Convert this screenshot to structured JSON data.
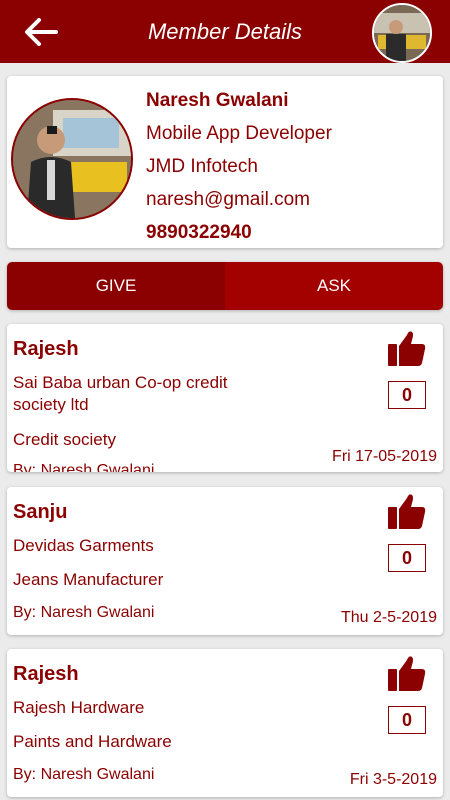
{
  "header": {
    "title": "Member Details"
  },
  "profile": {
    "name": "Naresh Gwalani",
    "designation": "Mobile App Developer",
    "company": "JMD Infotech",
    "email": "naresh@gmail.com",
    "phone": "9890322940"
  },
  "tabs": [
    {
      "label": "GIVE",
      "active": true
    },
    {
      "label": "ASK",
      "active": false
    }
  ],
  "entries": [
    {
      "name": "Rajesh",
      "business": "Sai Baba urban Co-op credit society ltd",
      "category": "Credit society",
      "by": "By: Naresh Gwalani",
      "date": "Fri 17-05-2019",
      "likes": "0"
    },
    {
      "name": "Sanju",
      "business": "Devidas Garments",
      "category": "Jeans Manufacturer",
      "by": "By: Naresh Gwalani",
      "date": "Thu 2-5-2019",
      "likes": "0"
    },
    {
      "name": "Rajesh",
      "business": "Rajesh Hardware",
      "category": "Paints and Hardware",
      "by": "By: Naresh Gwalani",
      "date": "Fri 3-5-2019",
      "likes": "0"
    }
  ],
  "colors": {
    "primary": "#8b0000",
    "tab_inactive": "#a30000",
    "background": "#ebebeb"
  },
  "icons": {
    "back": "arrow-left-icon",
    "like": "thumbs-up-icon"
  }
}
